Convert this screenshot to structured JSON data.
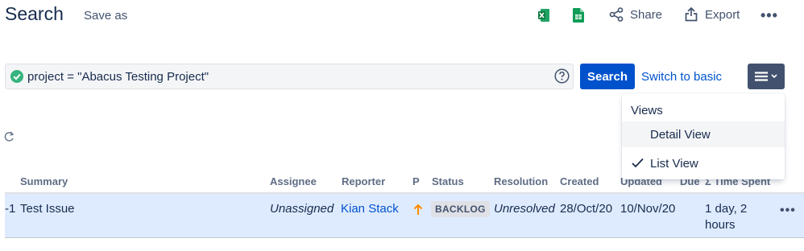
{
  "header": {
    "title": "Search",
    "save_as": "Save as",
    "share": "Share",
    "export": "Export"
  },
  "query": {
    "text": "project = \"Abacus Testing Project\"",
    "search_button": "Search",
    "switch_basic": "Switch to basic"
  },
  "views_menu": {
    "header": "Views",
    "items": [
      {
        "label": "Detail View",
        "selected": false
      },
      {
        "label": "List View",
        "selected": true
      }
    ]
  },
  "table": {
    "columns": [
      "Summary",
      "Assignee",
      "Reporter",
      "P",
      "Status",
      "Resolution",
      "Created",
      "Updated",
      "Due",
      "Σ Time Spent"
    ],
    "rows": [
      {
        "key_fragment": "-1",
        "summary": "Test Issue",
        "assignee": "Unassigned",
        "reporter": "Kian Stack",
        "status": "BACKLOG",
        "resolution": "Unresolved",
        "created": "28/Oct/20",
        "updated": "10/Nov/20",
        "time_spent_line1": "1 day, 2",
        "time_spent_line2": "hours"
      }
    ]
  },
  "colors": {
    "primary": "#0052cc",
    "text": "#172b4d",
    "row_highlight": "#deebff",
    "success": "#36b37e",
    "priority": "#ff8b00"
  }
}
